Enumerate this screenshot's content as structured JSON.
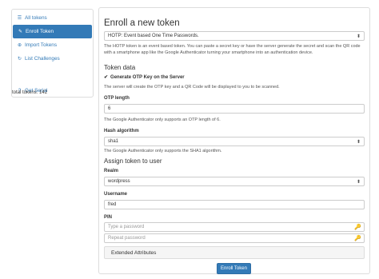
{
  "sidebar": {
    "items": [
      {
        "label": "All tokens",
        "icon": "list-icon"
      },
      {
        "label": "Enroll Token",
        "icon": "edit-icon"
      },
      {
        "label": "Import Tokens",
        "icon": "import-icon"
      },
      {
        "label": "List Challenges",
        "icon": "refresh-icon"
      }
    ],
    "get_serial": "Get Serial",
    "total": "total tokens: 142"
  },
  "main": {
    "title": "Enroll a new token",
    "type_select": "HOTP: Event based One Time Passwords.",
    "type_description": "The HOTP token is an event based token. You can paste a secret key or have the server generate the secret and scan the QR code with a smartphone app like the Google Authenticator turning your smartphone into an authentication device.",
    "token_data_heading": "Token data",
    "genkey_label": "Generate OTP Key on the Server",
    "genkey_help": "The server will create the OTP key and a QR Code will be displayed to you to be scanned.",
    "otplen_label": "OTP length",
    "otplen_value": "6",
    "otplen_help": "The Google Authenticator only supports an OTP length of 6.",
    "hash_label": "Hash algorithm",
    "hash_value": "sha1",
    "hash_help": "The Google Authenticator only supports the SHA1 algorithm.",
    "assign_heading": "Assign token to user",
    "realm_label": "Realm",
    "realm_value": "wordpress",
    "username_label": "Username",
    "username_value": "fred",
    "pin_label": "PIN",
    "pin_placeholder": "Type a password",
    "pin_repeat_placeholder": "Repeat password",
    "extended": "Extended Attributes",
    "enroll_button": "Enroll Token"
  },
  "colors": {
    "primary": "#337ab7",
    "key_icon": "#3a9ad9"
  }
}
